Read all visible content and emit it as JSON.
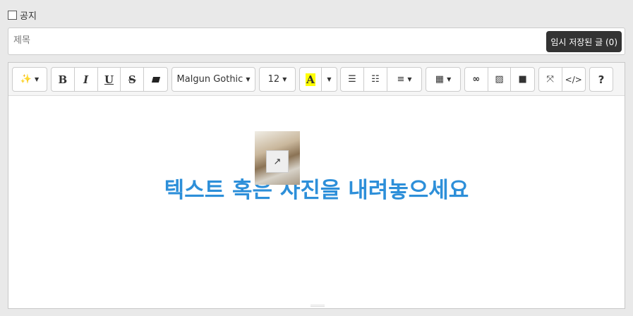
{
  "notice": {
    "label": "공지",
    "checked": false
  },
  "title": {
    "placeholder": "제목",
    "value": ""
  },
  "draft_button": "임시 저장된 글 (0)",
  "toolbar": {
    "style": "magic-wand-icon",
    "bold": "B",
    "italic": "I",
    "underline": "U",
    "strike": "S",
    "font_name": "Malgun Gothic",
    "font_size": "12",
    "color_label": "A",
    "highlight_color": "#ffff00",
    "help": "?",
    "code": "</>"
  },
  "content": {
    "placeholder_text": "텍스트 혹은 사진을 내려놓으세요",
    "accent_color": "#2d8fd9"
  }
}
